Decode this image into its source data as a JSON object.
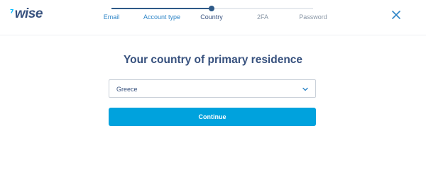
{
  "app": {
    "logo_flag": "⁷",
    "logo_text": "wise"
  },
  "stepper": {
    "steps": [
      {
        "label": "Email",
        "state": "done"
      },
      {
        "label": "Account type",
        "state": "done"
      },
      {
        "label": "Country",
        "state": "active"
      },
      {
        "label": "2FA",
        "state": "todo"
      },
      {
        "label": "Password",
        "state": "todo"
      }
    ]
  },
  "main": {
    "title": "Your country of primary residence",
    "country_select": {
      "value": "Greece"
    },
    "continue_label": "Continue"
  },
  "icons": {
    "close": "close-icon",
    "chevron": "chevron-down-icon"
  },
  "colors": {
    "brand_navy": "#37517e",
    "accent_blue": "#00a2dd",
    "logo_flag": "#00b9ff",
    "progress_done": "#2e5a88"
  }
}
